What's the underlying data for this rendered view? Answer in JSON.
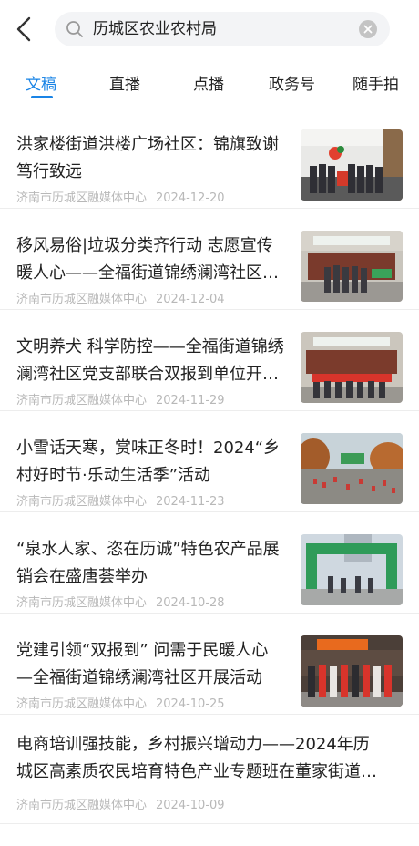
{
  "search": {
    "value": "历城区农业农村局"
  },
  "tabs": [
    {
      "label": "文稿",
      "active": true
    },
    {
      "label": "直播",
      "active": false
    },
    {
      "label": "点播",
      "active": false
    },
    {
      "label": "政务号",
      "active": false
    },
    {
      "label": "随手拍",
      "active": false
    }
  ],
  "articles": [
    {
      "title": "洪家楼街道洪楼广场社区：锦旗致谢 笃行致远",
      "source": "济南市历城区融媒体中心",
      "date": "2024-12-20",
      "has_image": true
    },
    {
      "title": "移风易俗|垃圾分类齐行动 志愿宣传暖人心——全福街道锦绣澜湾社区开展垃圾分类宣传活动",
      "source": "济南市历城区融媒体中心",
      "date": "2024-12-04",
      "has_image": true
    },
    {
      "title": "文明养犬 科学防控——全福街道锦绣澜湾社区党支部联合双报到单位开展文明养犬宣传活动",
      "source": "济南市历城区融媒体中心",
      "date": "2024-11-29",
      "has_image": true
    },
    {
      "title": "小雪话天寒，赏味正冬时！2024“乡村好时节·乐动生活季”活动",
      "source": "济南市历城区融媒体中心",
      "date": "2024-11-23",
      "has_image": true
    },
    {
      "title": "“泉水人家、恣在历诚”特色农产品展销会在盛唐荟举办",
      "source": "济南市历城区融媒体中心",
      "date": "2024-10-28",
      "has_image": true
    },
    {
      "title": "党建引领“双报到” 问需于民暖人心 —全福街道锦绣澜湾社区开展活动",
      "source": "济南市历城区融媒体中心",
      "date": "2024-10-25",
      "has_image": true
    },
    {
      "title": "电商培训强技能，乡村振兴增动力——2024年历城区高素质农民培育特色产业专题班在董家街道开班",
      "source": "济南市历城区融媒体中心",
      "date": "2024-10-09",
      "has_image": false
    }
  ]
}
